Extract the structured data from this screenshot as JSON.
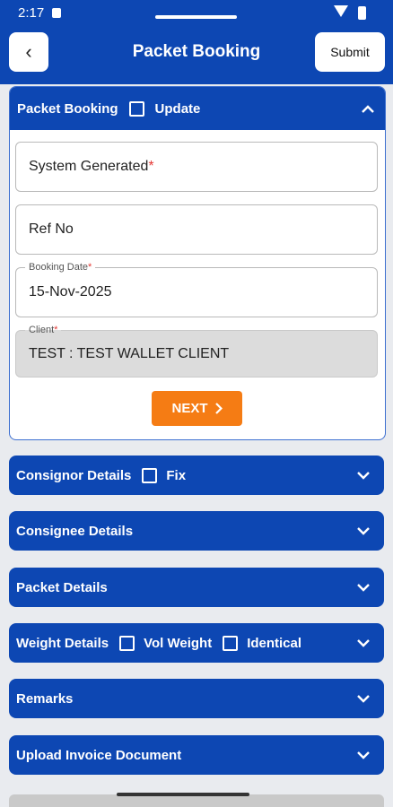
{
  "status_bar": {
    "time": "2:17"
  },
  "header": {
    "title": "Packet Booking",
    "submit_label": "Submit",
    "back_symbol": "‹"
  },
  "booking": {
    "title": "Packet Booking",
    "update_label": "Update",
    "fields": {
      "system_generated": {
        "placeholder": "System Generated",
        "required": "*"
      },
      "ref_no": {
        "placeholder": "Ref No"
      },
      "booking_date": {
        "label": "Booking Date",
        "required": "*",
        "value": "15-Nov-2025"
      },
      "client": {
        "label": "Client",
        "required": "*",
        "value": "TEST : TEST WALLET CLIENT"
      }
    },
    "next_label": "NEXT"
  },
  "sections": {
    "consignor": {
      "title": "Consignor Details",
      "fix_label": "Fix"
    },
    "consignee": {
      "title": "Consignee Details"
    },
    "packet": {
      "title": "Packet Details"
    },
    "weight": {
      "title": "Weight Details",
      "vol_label": "Vol Weight",
      "identical_label": "Identical"
    },
    "remarks": {
      "title": "Remarks"
    },
    "upload": {
      "title": "Upload Invoice Document"
    }
  },
  "colors": {
    "primary": "#0d47b3",
    "accent": "#f57c14"
  }
}
